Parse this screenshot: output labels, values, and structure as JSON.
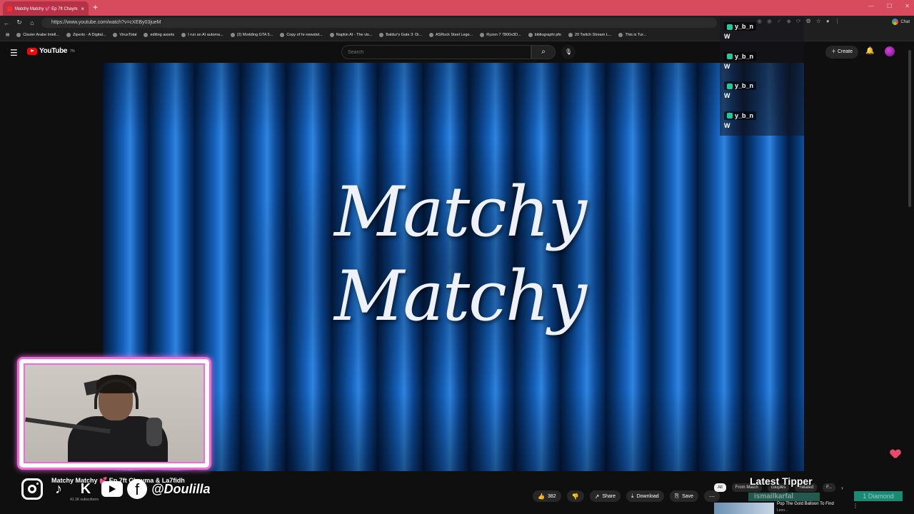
{
  "browser": {
    "tab_title": "Matchy Matchy 💕 Ep 7ft Chayma",
    "tab_close": "×",
    "new_tab": "+",
    "url": "https://www.youtube.com/watch?v=cXEBy03jueM",
    "chat_label": "Chat",
    "bookmarks": [
      "Clavier Arabe Intell...",
      "Ziperto - A Digital...",
      "VirusTotal",
      "editing assets",
      "I run an AI automa...",
      "(2) Modding GTA 5...",
      "Copy of hr-newslet...",
      "Napkin AI - The vis...",
      "Baldur's Gate 3: Di...",
      "ASRock Steel Lege...",
      "Ryzen 7 7800x3D...",
      "bibliographi pfe",
      "20 Twitch Stream L...",
      "This is Tur..."
    ]
  },
  "youtube": {
    "logo_text": "YouTube",
    "logo_sup": "TN",
    "search_placeholder": "Search",
    "create_label": "Create",
    "video_title_overlay": "Matchy Matchy",
    "video_title": "Matchy Matchy 💕 Ep 7ft Chayma & La7fidh",
    "subscribers": "41.1K subscribers",
    "likes": "382",
    "share_label": "Share",
    "download_label": "Download",
    "save_label": "Save",
    "chips": [
      "All",
      "From Match",
      "couples",
      "Related",
      "F..."
    ],
    "rec_title": "Pop The Gold Balloon To Find",
    "rec_sub": "Leon..."
  },
  "stream_overlay": {
    "chat_messages": [
      {
        "user": "y_b_n",
        "text": "W"
      },
      {
        "user": "y_b_n",
        "text": "W"
      },
      {
        "user": "y_b_n",
        "text": "W"
      },
      {
        "user": "y_b_n",
        "text": "W"
      }
    ],
    "social_handle": "@Doulilla",
    "latest_tipper_label": "Latest Tipper",
    "tipper_name": "ismailkarfal",
    "tip_amount": "1 Diamond"
  },
  "colors": {
    "tabbar": "#d84a5e",
    "youtube_red": "#ff0000",
    "webcam_border": "#f26bdc",
    "chat_badge": "#20c997"
  }
}
